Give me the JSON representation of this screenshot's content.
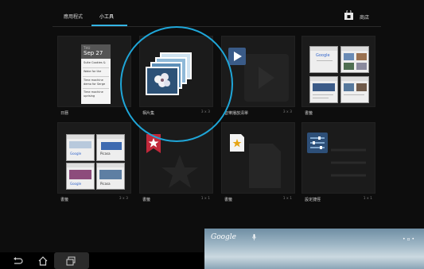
{
  "tabs": {
    "apps": "應用程式",
    "widgets": "小工具"
  },
  "store": {
    "label": "商店",
    "icon": "store-bag-icon"
  },
  "widgets": [
    {
      "label": "日曆",
      "size": ""
    },
    {
      "label": "相片集",
      "size": "3 x 3"
    },
    {
      "label": "音樂播放清單",
      "size": "3 x 3"
    },
    {
      "label": "書籤",
      "size": ""
    },
    {
      "label": "書籤",
      "size": "3 x 3"
    },
    {
      "label": "書籤",
      "size": "1 x 1"
    },
    {
      "label": "書籤",
      "size": "1 x 1"
    },
    {
      "label": "設定捷徑",
      "size": "1 x 1"
    }
  ],
  "calendar": {
    "day": "THU",
    "date": "Sep 27",
    "items": [
      "Suite Cookies &",
      "Wake for the",
      "Time machine",
      "demo for Serge",
      "Time machine",
      "uprising"
    ]
  },
  "thumbs": {
    "google_logo": "Google",
    "bookmark_labels": [
      "Google",
      "Picasa",
      "Google",
      "Picasa"
    ]
  },
  "wallpaper": {
    "google": "Google",
    "dots": "• ▫ •"
  },
  "navbar": {
    "back": "back-icon",
    "home": "home-icon",
    "recent": "recent-apps-icon"
  },
  "colors": {
    "accent": "#33b5e5",
    "circle": "#1fa6d8",
    "background": "#0d0d0d"
  }
}
